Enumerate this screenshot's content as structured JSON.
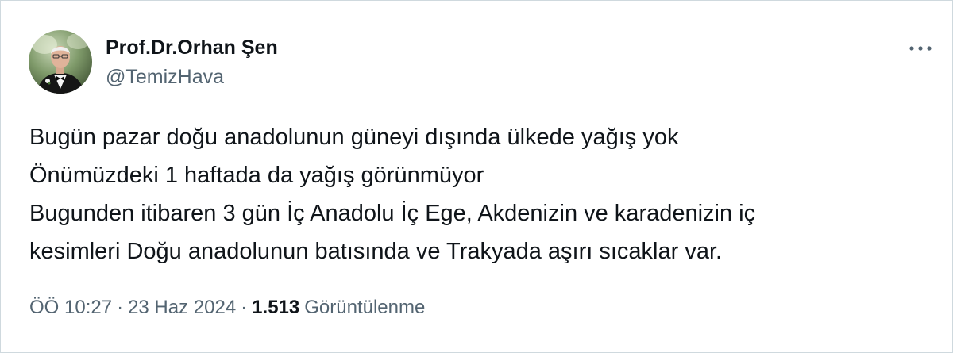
{
  "author": {
    "display_name": "Prof.Dr.Orhan Şen",
    "handle": "@TemizHava"
  },
  "more_menu": {
    "icon": "more-horizontal-icon"
  },
  "tweet": {
    "lines": [
      "Bugün pazar doğu anadolunun güneyi dışında ülkede yağış yok",
      "Önümüzdeki 1 haftada da yağış görünmüyor",
      "Bugunden itibaren 3 gün İç Anadolu İç Ege, Akdenizin ve karadenizin iç",
      "kesimleri Doğu anadolunun batısında ve Trakyada aşırı sıcaklar var."
    ]
  },
  "meta": {
    "time": "ÖÖ 10:27",
    "separator": "·",
    "date": "23 Haz 2024",
    "views_count": "1.513",
    "views_label": "Görüntülenme"
  },
  "colors": {
    "text_primary": "#0f1419",
    "text_secondary": "#536471",
    "border": "#cfd9de",
    "background": "#ffffff"
  }
}
